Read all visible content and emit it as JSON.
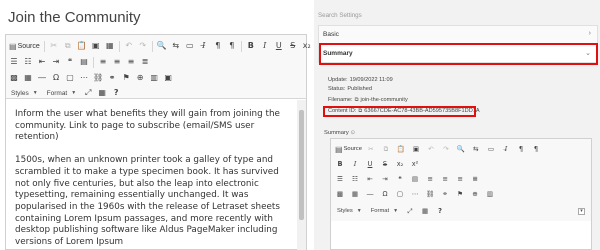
{
  "page": {
    "title": "Join the Community"
  },
  "toolbar": {
    "source_label": "Source",
    "styles_label": "Styles",
    "format_label": "Format",
    "help_label": "?"
  },
  "content": {
    "paragraphs": [
      "Inform the user what benefits they will gain from joining the community. Link to page to subscribe (email/SMS user retention)",
      "1500s, when an unknown printer took a galley of type and scrambled it to make a type specimen book. It has survived not only five centuries, but also the leap into electronic typesetting, remaining essentially unchanged. It was popularised in the 1960s with the release of Letraset sheets containing Lorem Ipsum passages, and more recently with desktop publishing software like Aldus PageMaker including versions of Lorem Ipsum"
    ]
  },
  "settings": {
    "search_placeholder": "Search Settings",
    "basic_label": "Basic",
    "summary_label": "Summary",
    "update_label": "Update:",
    "update_value": "19/09/2022 11:09",
    "status_label": "Status:",
    "status_value": "Published",
    "filename_label": "Filename:",
    "filename_value": "join-the-community",
    "content_id_label": "Content ID:",
    "content_id_value": "63667CDE-AC78-43BB-AD595735B8F1DD1A",
    "summary_field_label": "Summary"
  },
  "colors": {
    "highlight": "#e01010",
    "panel_bg": "#f2f2f2"
  }
}
